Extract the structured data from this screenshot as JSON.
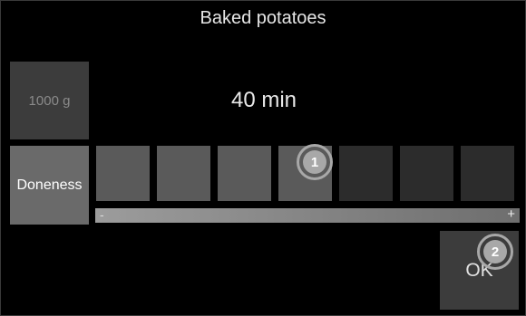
{
  "header": {
    "title": "Baked potatoes"
  },
  "weight": {
    "label": "1000 g"
  },
  "time": {
    "value": "40 min"
  },
  "doneness": {
    "label": "Doneness",
    "level": 4,
    "max_level": 7,
    "minus_label": "-",
    "plus_label": "+"
  },
  "ok": {
    "label": "OK"
  },
  "callouts": [
    {
      "number": "1"
    },
    {
      "number": "2"
    }
  ],
  "colors": {
    "background": "#000000",
    "segment_active": "#5a5a5a",
    "segment_inactive": "#2c2c2c",
    "callout": "#a8a8a8"
  }
}
